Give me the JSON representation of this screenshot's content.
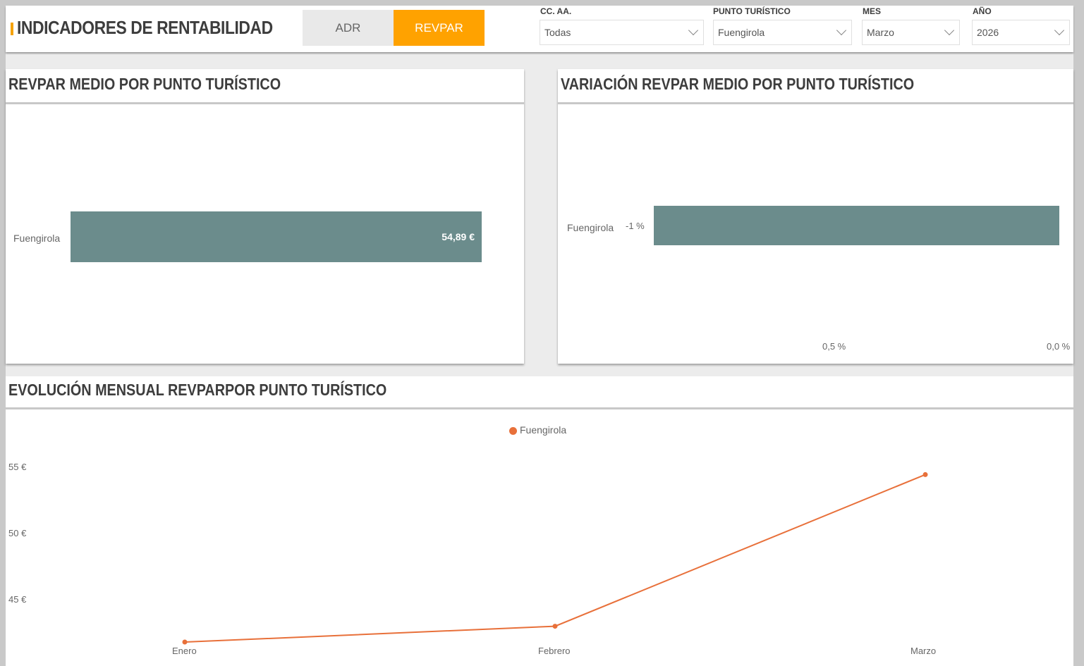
{
  "header": {
    "title": "INDICADORES DE RENTABILIDAD",
    "toggles": {
      "adr": "ADR",
      "revpar": "REVPAR"
    },
    "accent_color": "#ffa200",
    "filters": {
      "ccaa": {
        "label": "CC. AA.",
        "value": "Todas"
      },
      "punto": {
        "label": "PUNTO TURÍSTICO",
        "value": "Fuengirola"
      },
      "mes": {
        "label": "MES",
        "value": "Marzo"
      },
      "anio": {
        "label": "AÑO",
        "value": "2026"
      }
    }
  },
  "panels": {
    "revpar_medio": {
      "title": "REVPAR MEDIO POR PUNTO TURÍSTICO",
      "category": "Fuengirola",
      "value_label": "54,89 €"
    },
    "variacion": {
      "title": "VARIACIÓN REVPAR MEDIO POR PUNTO TURÍSTICO",
      "category": "Fuengirola",
      "value_label": "-1 %",
      "ticks": [
        "0,5 %",
        "0,0 %"
      ]
    },
    "evolucion": {
      "title": "EVOLUCIÓN MENSUAL REVPARPOR PUNTO TURÍSTICO",
      "legend": "Fuengirola",
      "y_ticks": [
        "55 €",
        "50 €",
        "45 €"
      ],
      "x_ticks": [
        "Enero",
        "Febrero",
        "Marzo"
      ]
    }
  },
  "chart_data": [
    {
      "type": "bar",
      "title": "REVPAR MEDIO POR PUNTO TURÍSTICO",
      "categories": [
        "Fuengirola"
      ],
      "values": [
        54.89
      ],
      "unit": "€",
      "color": "#6b8c8c"
    },
    {
      "type": "bar",
      "title": "VARIACIÓN REVPAR MEDIO POR PUNTO TURÍSTICO",
      "categories": [
        "Fuengirola"
      ],
      "values": [
        -1
      ],
      "unit": "%",
      "color": "#6b8c8c"
    },
    {
      "type": "line",
      "title": "EVOLUCIÓN MENSUAL REVPARPOR PUNTO TURÍSTICO",
      "categories": [
        "Enero",
        "Febrero",
        "Marzo"
      ],
      "series": [
        {
          "name": "Fuengirola",
          "values": [
            42.3,
            43.5,
            55.0
          ],
          "color": "#e8703a"
        }
      ],
      "ylim": [
        41.5,
        57
      ],
      "y_ticks": [
        45,
        50,
        55
      ],
      "legend_position": "top-center",
      "grid": false
    }
  ]
}
